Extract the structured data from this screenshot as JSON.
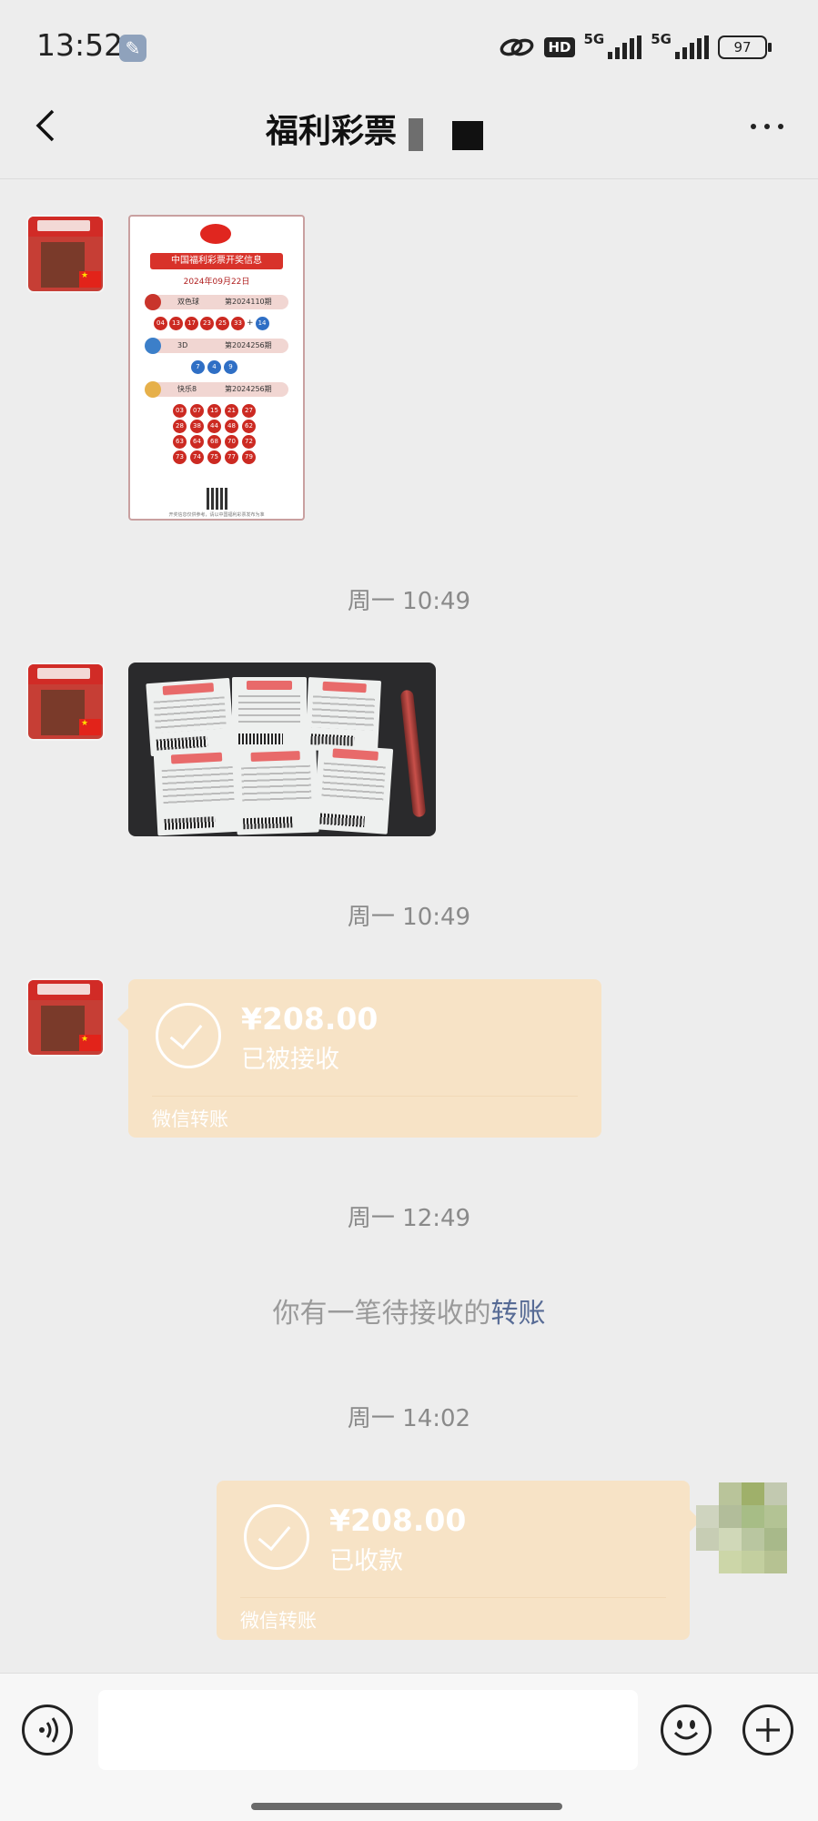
{
  "status_bar": {
    "time": "13:52",
    "network_1": "5G",
    "network_2": "5G",
    "hd_label": "HD",
    "battery": "97",
    "icons": [
      "wrench-icon",
      "link-icon",
      "hd-icon",
      "signal-icon",
      "signal-icon",
      "battery-icon"
    ]
  },
  "header": {
    "title": "福利彩票",
    "back_icon": "chevron-left-icon",
    "more_icon": "more-dots-icon"
  },
  "lottery_image": {
    "heading": "中国福利彩票开奖信息",
    "date": "2024年09月22日",
    "games": [
      {
        "name": "双色球",
        "issue": "第2024110期",
        "numbers": [
          "04",
          "13",
          "17",
          "23",
          "25",
          "33"
        ],
        "special": "14"
      },
      {
        "name": "3D",
        "issue": "第2024256期",
        "numbers": [
          "7",
          "4",
          "9"
        ]
      },
      {
        "name": "快乐8",
        "issue": "第2024256期",
        "numbers": [
          "03",
          "07",
          "15",
          "21",
          "27",
          "28",
          "38",
          "44",
          "48",
          "62",
          "63",
          "64",
          "68",
          "70",
          "72",
          "73",
          "74",
          "75",
          "77",
          "79"
        ]
      }
    ],
    "footer": "开奖信息仅供参考，请以中国福利彩票发布为准"
  },
  "messages": {
    "timestamp_1": "周一 10:49",
    "timestamp_2": "周一 10:49",
    "timestamp_3": "周一 12:49",
    "timestamp_4": "周一 14:02",
    "transfer_1": {
      "amount": "¥208.00",
      "status": "已被接收",
      "footer": "微信转账"
    },
    "transfer_2": {
      "amount": "¥208.00",
      "status": "已收款",
      "footer": "微信转账"
    },
    "system_text": "你有一笔待接收的",
    "system_link": "转账"
  },
  "colors": {
    "background": "#ededed",
    "transfer_card": "#f7e3c6",
    "link": "#576b95"
  },
  "input_bar": {
    "voice_icon": "voice-icon",
    "emoji_icon": "emoji-icon",
    "plus_icon": "plus-icon"
  }
}
